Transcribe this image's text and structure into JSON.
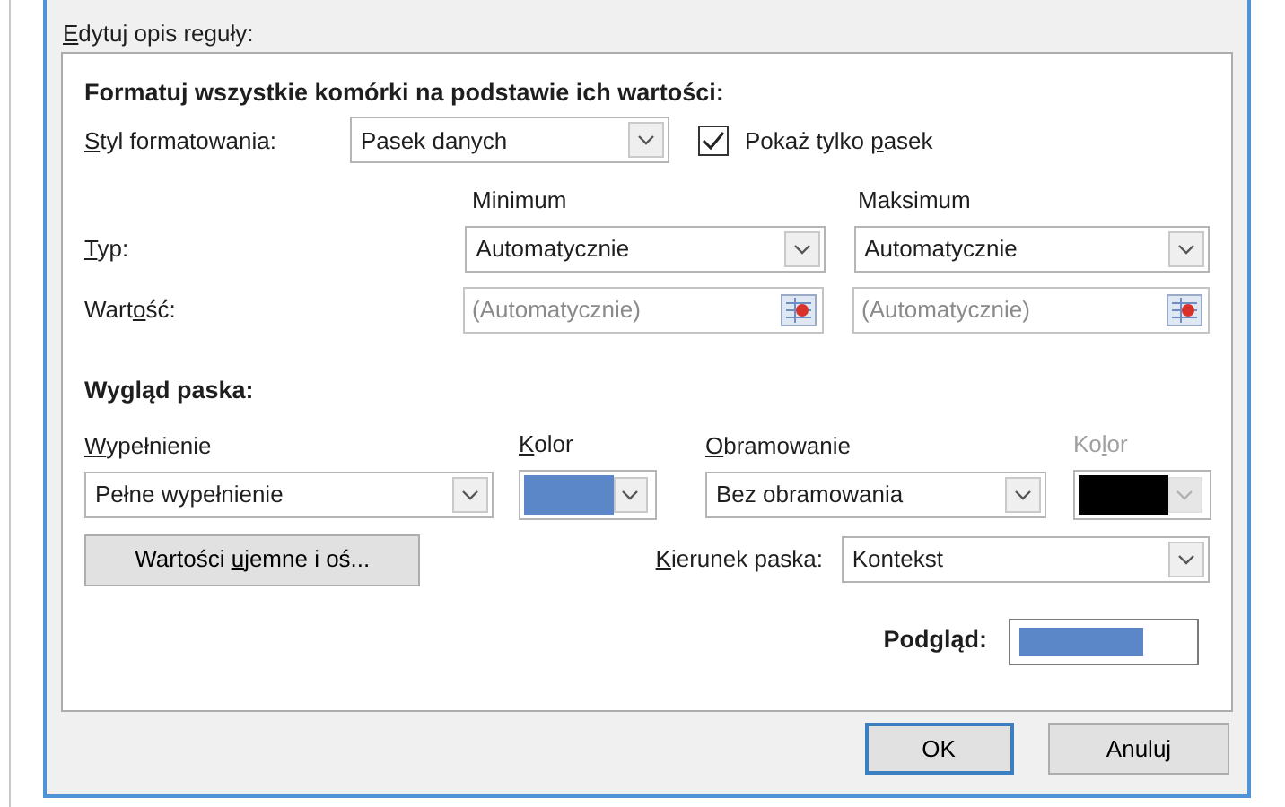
{
  "section_label": {
    "key": "E",
    "after": "dytuj opis reguły:"
  },
  "panel": {
    "heading": "Formatuj wszystkie komórki na podstawie ich wartości:",
    "format_style": {
      "label": {
        "key": "S",
        "after": "tyl formatowania:"
      },
      "value": "Pasek danych"
    },
    "show_bar_only": {
      "label": {
        "before": "Pokaż tylko ",
        "key": "p",
        "after": "asek"
      },
      "checked": true
    },
    "columns": [
      "Minimum",
      "Maksimum"
    ],
    "type_row": {
      "label": {
        "key": "T",
        "after": "yp:"
      },
      "values": [
        "Automatycznie",
        "Automatycznie"
      ]
    },
    "value_row": {
      "label": {
        "before": "Wart",
        "key": "o",
        "after": "ść:"
      },
      "placeholders": [
        "(Automatycznie)",
        "(Automatycznie)"
      ]
    },
    "appearance_heading": "Wygląd paska:",
    "fill": {
      "label": {
        "key": "W",
        "after": "ypełnienie"
      },
      "value": "Pełne wypełnienie"
    },
    "fill_color": {
      "label": {
        "key": "K",
        "after": "olor"
      },
      "color": "#5b87c8",
      "disabled": false
    },
    "border": {
      "label": {
        "key": "O",
        "after": "bramowanie"
      },
      "value": "Bez obramowania"
    },
    "border_color": {
      "label": {
        "before": "Ko",
        "key": "l",
        "after": "or"
      },
      "color": "#000000",
      "disabled": true
    },
    "negative_button": {
      "before": "Wartości ",
      "key": "u",
      "after": "jemne i oś..."
    },
    "direction": {
      "label": {
        "key": "K",
        "after": "ierunek paska:"
      },
      "value": "Kontekst"
    },
    "preview": {
      "label": "Podgląd:",
      "color": "#5b87c8",
      "level": 0.73
    }
  },
  "buttons": [
    {
      "label": "OK",
      "default": true
    },
    {
      "label": "Anuluj",
      "default": false
    }
  ]
}
